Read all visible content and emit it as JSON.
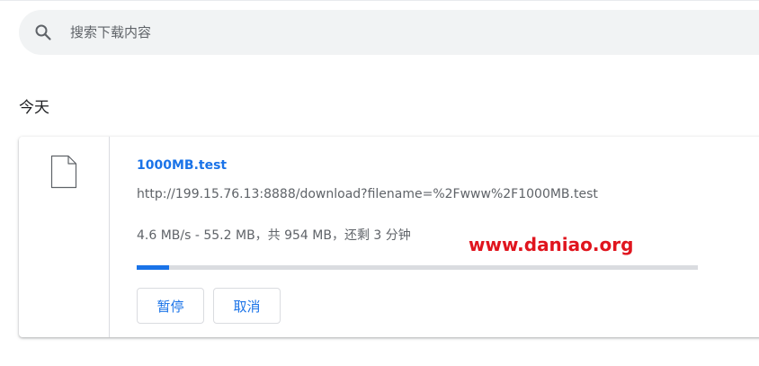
{
  "search": {
    "placeholder": "搜索下载内容"
  },
  "section": {
    "heading": "今天"
  },
  "download": {
    "file_name": "1000MB.test",
    "url": "http://199.15.76.13:8888/download?filename=%2Fwww%2F1000MB.test",
    "status": "4.6 MB/s - 55.2 MB，共 954 MB，还剩 3 分钟",
    "progress_fraction": 0.0579,
    "pause_label": "暂停",
    "cancel_label": "取消"
  },
  "icons": {
    "search": "search-icon",
    "file": "file-icon"
  },
  "colors": {
    "accent": "#1a73e8",
    "watermark": "#e0151e",
    "progress_track": "#dadce0"
  },
  "watermark": {
    "text": "www.daniao.org"
  }
}
